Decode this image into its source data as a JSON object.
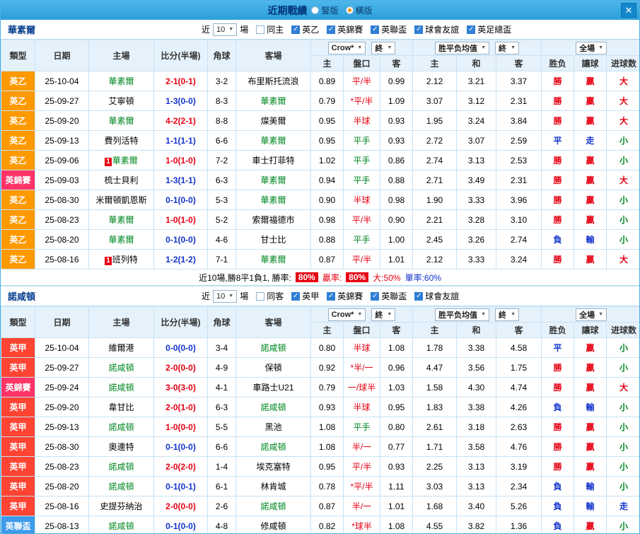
{
  "titlebar": {
    "title": "近期戰績",
    "radios": [
      {
        "label": "豎版",
        "selected": false
      },
      {
        "label": "橫版",
        "selected": true
      }
    ],
    "close_label": "✕"
  },
  "controls": {
    "near_label": "近",
    "near_value": "10",
    "games_label": "場",
    "odds_select": "Crow*",
    "final_select": "終",
    "avg_select": "胜平负均值",
    "fulltime_select": "全場"
  },
  "columns": {
    "type": "類型",
    "date": "日期",
    "home": "主場",
    "score": "比分(半場)",
    "corner": "角球",
    "away": "客場",
    "odds_home": "主",
    "odds_line": "盤口",
    "odds_away": "客",
    "avg_home": "主",
    "avg_draw": "和",
    "avg_away": "客",
    "res_wdl": "胜负",
    "res_handicap": "讓球",
    "res_goals": "进球数"
  },
  "colors": {
    "league": {
      "英乙": "#ff9900",
      "英甲": "#ff4433",
      "英錦賽": "#ff3366",
      "英聯盃": "#3d9be9"
    },
    "result": {
      "勝": "#e60012",
      "贏": "#e60012",
      "大": "#e60012",
      "平": "#1133cc",
      "負": "#1133cc",
      "走": "#1133cc",
      "輸": "#1133cc",
      "小": "#008822"
    },
    "score_home_win": "#e60012",
    "score_other": "#1133cc",
    "line_level": "#008822",
    "line_normal": "#e60012",
    "main_team": "#008822",
    "accent_blue": "#2ea7e0"
  },
  "tables": [
    {
      "team": "華素爾",
      "filters": [
        {
          "label": "同主",
          "checked": false
        },
        {
          "label": "英乙",
          "checked": true
        },
        {
          "label": "英錦賽",
          "checked": true
        },
        {
          "label": "英聯盃",
          "checked": true
        },
        {
          "label": "球會友誼",
          "checked": true
        },
        {
          "label": "英足總盃",
          "checked": true
        }
      ],
      "rows": [
        {
          "lg": "英乙",
          "date": "25-10-04",
          "home": "華素爾",
          "hb": "",
          "score": "2-1(0-1)",
          "corner": "3-2",
          "away": "布里斯托流浪",
          "ab": "",
          "o": [
            "0.89",
            "平/半",
            "0.99"
          ],
          "avg": [
            "2.12",
            "3.21",
            "3.37"
          ],
          "r": [
            "勝",
            "贏",
            "大"
          ]
        },
        {
          "lg": "英乙",
          "date": "25-09-27",
          "home": "艾寧頓",
          "hb": "",
          "score": "1-3(0-0)",
          "corner": "8-3",
          "away": "華素爾",
          "ab": "",
          "o": [
            "0.79",
            "*平/半",
            "1.09"
          ],
          "avg": [
            "3.07",
            "3.12",
            "2.31"
          ],
          "r": [
            "勝",
            "贏",
            "大"
          ]
        },
        {
          "lg": "英乙",
          "date": "25-09-20",
          "home": "華素爾",
          "hb": "",
          "score": "4-2(2-1)",
          "corner": "8-8",
          "away": "燦美爾",
          "ab": "",
          "o": [
            "0.95",
            "半球",
            "0.93"
          ],
          "avg": [
            "1.95",
            "3.24",
            "3.84"
          ],
          "r": [
            "勝",
            "贏",
            "大"
          ]
        },
        {
          "lg": "英乙",
          "date": "25-09-13",
          "home": "費列活特",
          "hb": "",
          "score": "1-1(1-1)",
          "corner": "6-6",
          "away": "華素爾",
          "ab": "",
          "o": [
            "0.95",
            "平手",
            "0.93"
          ],
          "avg": [
            "2.72",
            "3.07",
            "2.59"
          ],
          "r": [
            "平",
            "走",
            "小"
          ]
        },
        {
          "lg": "英乙",
          "date": "25-09-06",
          "home": "華素爾",
          "hb": "1",
          "score": "1-0(1-0)",
          "corner": "7-2",
          "away": "車士打菲特",
          "ab": "",
          "o": [
            "1.02",
            "平手",
            "0.86"
          ],
          "avg": [
            "2.74",
            "3.13",
            "2.53"
          ],
          "r": [
            "勝",
            "贏",
            "小"
          ]
        },
        {
          "lg": "英錦賽",
          "date": "25-09-03",
          "home": "梳士貝利",
          "hb": "",
          "score": "1-3(1-1)",
          "corner": "6-3",
          "away": "華素爾",
          "ab": "",
          "o": [
            "0.94",
            "平手",
            "0.88"
          ],
          "avg": [
            "2.71",
            "3.49",
            "2.31"
          ],
          "r": [
            "勝",
            "贏",
            "大"
          ]
        },
        {
          "lg": "英乙",
          "date": "25-08-30",
          "home": "米爾頓凱恩斯",
          "hb": "",
          "score": "0-1(0-0)",
          "corner": "5-3",
          "away": "華素爾",
          "ab": "",
          "o": [
            "0.90",
            "半球",
            "0.98"
          ],
          "avg": [
            "1.90",
            "3.33",
            "3.96"
          ],
          "r": [
            "勝",
            "贏",
            "小"
          ]
        },
        {
          "lg": "英乙",
          "date": "25-08-23",
          "home": "華素爾",
          "hb": "",
          "score": "1-0(1-0)",
          "corner": "5-2",
          "away": "索爾福德市",
          "ab": "",
          "o": [
            "0.98",
            "平/半",
            "0.90"
          ],
          "avg": [
            "2.21",
            "3.28",
            "3.10"
          ],
          "r": [
            "勝",
            "贏",
            "小"
          ]
        },
        {
          "lg": "英乙",
          "date": "25-08-20",
          "home": "華素爾",
          "hb": "",
          "score": "0-1(0-0)",
          "corner": "4-6",
          "away": "甘士比",
          "ab": "",
          "o": [
            "0.88",
            "平手",
            "1.00"
          ],
          "avg": [
            "2.45",
            "3.26",
            "2.74"
          ],
          "r": [
            "負",
            "輸",
            "小"
          ]
        },
        {
          "lg": "英乙",
          "date": "25-08-16",
          "home": "班列特",
          "hb": "1",
          "score": "1-2(1-2)",
          "corner": "7-1",
          "away": "華素爾",
          "ab": "",
          "o": [
            "0.87",
            "平/半",
            "1.01"
          ],
          "avg": [
            "2.12",
            "3.33",
            "3.24"
          ],
          "r": [
            "勝",
            "贏",
            "大"
          ]
        }
      ],
      "summary": {
        "prefix": "近10場,勝8平1負1, 勝率:",
        "win_rate": "80%",
        "handicap_label": "贏率:",
        "handicap_rate": "80%",
        "big_text": "大:50%",
        "odd_text": "單率:60%"
      }
    },
    {
      "team": "諾咸頓",
      "filters": [
        {
          "label": "同客",
          "checked": false
        },
        {
          "label": "英甲",
          "checked": true
        },
        {
          "label": "英錦賽",
          "checked": true
        },
        {
          "label": "英聯盃",
          "checked": true
        },
        {
          "label": "球會友誼",
          "checked": true
        }
      ],
      "rows": [
        {
          "lg": "英甲",
          "date": "25-10-04",
          "home": "維爾港",
          "hb": "",
          "score": "0-0(0-0)",
          "corner": "3-4",
          "away": "諾咸頓",
          "ab": "",
          "o": [
            "0.80",
            "半球",
            "1.08"
          ],
          "avg": [
            "1.78",
            "3.38",
            "4.58"
          ],
          "r": [
            "平",
            "贏",
            "小"
          ]
        },
        {
          "lg": "英甲",
          "date": "25-09-27",
          "home": "諾咸頓",
          "hb": "",
          "score": "2-0(0-0)",
          "corner": "4-9",
          "away": "保頓",
          "ab": "",
          "o": [
            "0.92",
            "*半/一",
            "0.96"
          ],
          "avg": [
            "4.47",
            "3.56",
            "1.75"
          ],
          "r": [
            "勝",
            "贏",
            "小"
          ]
        },
        {
          "lg": "英錦賽",
          "date": "25-09-24",
          "home": "諾咸頓",
          "hb": "",
          "score": "3-0(3-0)",
          "corner": "4-1",
          "away": "車路士U21",
          "ab": "",
          "o": [
            "0.79",
            "一/球半",
            "1.03"
          ],
          "avg": [
            "1.58",
            "4.30",
            "4.74"
          ],
          "r": [
            "勝",
            "贏",
            "大"
          ]
        },
        {
          "lg": "英甲",
          "date": "25-09-20",
          "home": "韋甘比",
          "hb": "",
          "score": "2-0(1-0)",
          "corner": "6-3",
          "away": "諾咸頓",
          "ab": "",
          "o": [
            "0.93",
            "半球",
            "0.95"
          ],
          "avg": [
            "1.83",
            "3.38",
            "4.26"
          ],
          "r": [
            "負",
            "輸",
            "小"
          ]
        },
        {
          "lg": "英甲",
          "date": "25-09-13",
          "home": "諾咸頓",
          "hb": "",
          "score": "1-0(0-0)",
          "corner": "5-5",
          "away": "黑池",
          "ab": "",
          "o": [
            "1.08",
            "平手",
            "0.80"
          ],
          "avg": [
            "2.61",
            "3.18",
            "2.63"
          ],
          "r": [
            "勝",
            "贏",
            "小"
          ]
        },
        {
          "lg": "英甲",
          "date": "25-08-30",
          "home": "奧連特",
          "hb": "",
          "score": "0-1(0-0)",
          "corner": "6-6",
          "away": "諾咸頓",
          "ab": "",
          "o": [
            "1.08",
            "半/一",
            "0.77"
          ],
          "avg": [
            "1.71",
            "3.58",
            "4.76"
          ],
          "r": [
            "勝",
            "贏",
            "小"
          ]
        },
        {
          "lg": "英甲",
          "date": "25-08-23",
          "home": "諾咸頓",
          "hb": "",
          "score": "2-0(2-0)",
          "corner": "1-4",
          "away": "埃克塞特",
          "ab": "",
          "o": [
            "0.95",
            "平/半",
            "0.93"
          ],
          "avg": [
            "2.25",
            "3.13",
            "3.19"
          ],
          "r": [
            "勝",
            "贏",
            "小"
          ]
        },
        {
          "lg": "英甲",
          "date": "25-08-20",
          "home": "諾咸頓",
          "hb": "",
          "score": "0-1(0-1)",
          "corner": "6-1",
          "away": "林肯城",
          "ab": "",
          "o": [
            "0.78",
            "*平/半",
            "1.11"
          ],
          "avg": [
            "3.03",
            "3.13",
            "2.34"
          ],
          "r": [
            "負",
            "輸",
            "小"
          ]
        },
        {
          "lg": "英甲",
          "date": "25-08-16",
          "home": "史提芬納治",
          "hb": "",
          "score": "2-0(0-0)",
          "corner": "2-6",
          "away": "諾咸頓",
          "ab": "",
          "o": [
            "0.87",
            "半/一",
            "1.01"
          ],
          "avg": [
            "1.68",
            "3.40",
            "5.26"
          ],
          "r": [
            "負",
            "輸",
            "走"
          ]
        },
        {
          "lg": "英聯盃",
          "date": "25-08-13",
          "home": "諾咸頓",
          "hb": "",
          "score": "0-1(0-0)",
          "corner": "4-8",
          "away": "修咸頓",
          "ab": "",
          "o": [
            "0.82",
            "*球半",
            "1.08"
          ],
          "avg": [
            "4.55",
            "3.82",
            "1.36"
          ],
          "r": [
            "負",
            "贏",
            "小"
          ]
        }
      ]
    }
  ]
}
